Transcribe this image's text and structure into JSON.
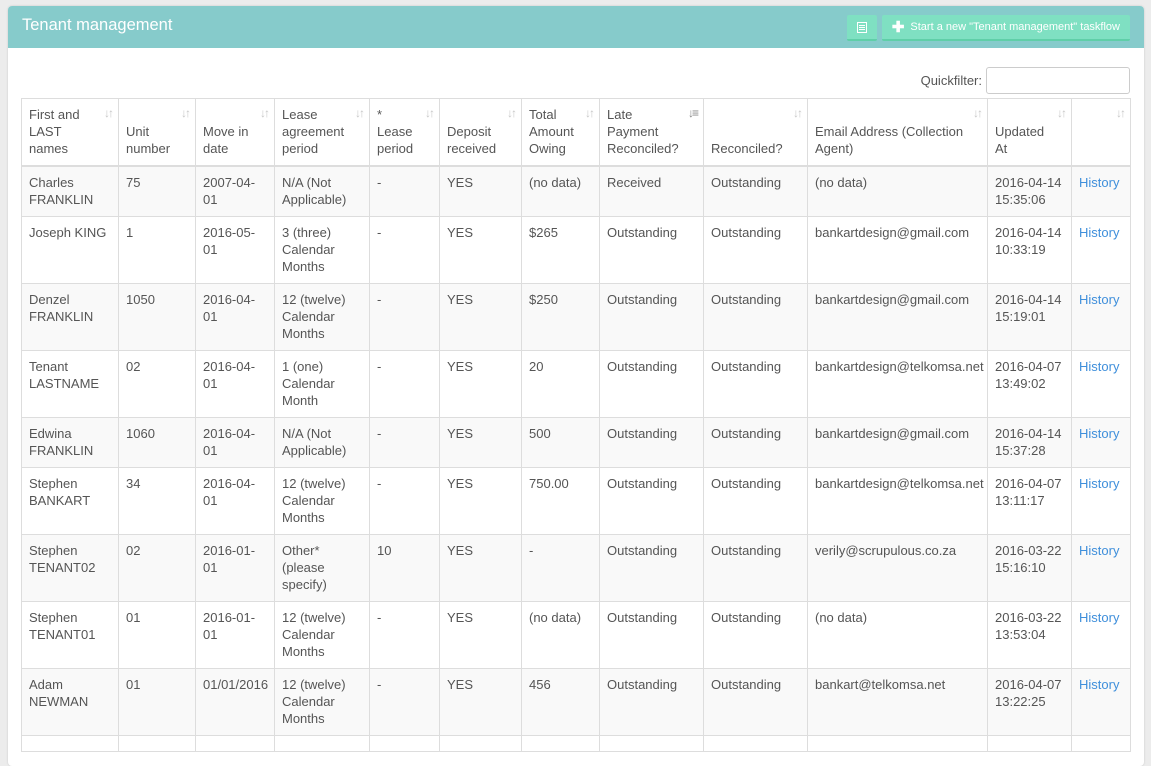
{
  "header": {
    "title": "Tenant management",
    "list_button_icon": "list-icon",
    "start_button_icon": "plus-icon",
    "start_button_label": "Start a new \"Tenant management\"  taskflow"
  },
  "filter": {
    "label": "Quickfilter:",
    "value": "",
    "placeholder": ""
  },
  "table": {
    "columns": [
      {
        "label": "First and LAST names",
        "sort": "unsorted"
      },
      {
        "label": "Unit number",
        "sort": "unsorted"
      },
      {
        "label": "Move in date",
        "sort": "unsorted"
      },
      {
        "label": "Lease agreement period",
        "sort": "unsorted"
      },
      {
        "label": "* Lease period",
        "sort": "unsorted"
      },
      {
        "label": "Deposit received",
        "sort": "unsorted"
      },
      {
        "label": "Total Amount Owing",
        "sort": "unsorted"
      },
      {
        "label": "Late Payment Reconciled?",
        "sort": "descending"
      },
      {
        "label": "Reconciled?",
        "sort": "unsorted"
      },
      {
        "label": "Email Address (Collection Agent)",
        "sort": "unsorted"
      },
      {
        "label": "Updated At",
        "sort": "unsorted"
      },
      {
        "label": "",
        "sort": "unsorted"
      }
    ],
    "rows": [
      [
        "Charles FRANKLIN",
        "75",
        "2007-04-01",
        "N/A (Not Applicable)",
        "-",
        "YES",
        "(no data)",
        "Received",
        "Outstanding",
        "(no data)",
        "2016-04-14 15:35:06",
        "History"
      ],
      [
        "Joseph KING",
        "1",
        "2016-05-01",
        "3 (three) Calendar Months",
        "-",
        "YES",
        "$265",
        "Outstanding",
        "Outstanding",
        "bankartdesign@gmail.com",
        "2016-04-14 10:33:19",
        "History"
      ],
      [
        "Denzel FRANKLIN",
        "1050",
        "2016-04-01",
        "12 (twelve) Calendar Months",
        "-",
        "YES",
        "$250",
        "Outstanding",
        "Outstanding",
        "bankartdesign@gmail.com",
        "2016-04-14 15:19:01",
        "History"
      ],
      [
        "Tenant LASTNAME",
        "02",
        "2016-04-01",
        "1 (one) Calendar Month",
        "-",
        "YES",
        "20",
        "Outstanding",
        "Outstanding",
        "bankartdesign@telkomsa.net",
        "2016-04-07 13:49:02",
        "History"
      ],
      [
        "Edwina FRANKLIN",
        "1060",
        "2016-04-01",
        "N/A (Not Applicable)",
        "-",
        "YES",
        "500",
        "Outstanding",
        "Outstanding",
        "bankartdesign@gmail.com",
        "2016-04-14 15:37:28",
        "History"
      ],
      [
        "Stephen BANKART",
        "34",
        "2016-04-01",
        "12 (twelve) Calendar Months",
        "-",
        "YES",
        "750.00",
        "Outstanding",
        "Outstanding",
        "bankartdesign@telkomsa.net",
        "2016-04-07 13:11:17",
        "History"
      ],
      [
        "Stephen TENANT02",
        "02",
        "2016-01-01",
        "Other* (please specify)",
        "10",
        "YES",
        "-",
        "Outstanding",
        "Outstanding",
        "verily@scrupulous.co.za",
        "2016-03-22 15:16:10",
        "History"
      ],
      [
        "Stephen TENANT01",
        "01",
        "2016-01-01",
        "12 (twelve) Calendar Months",
        "-",
        "YES",
        "(no data)",
        "Outstanding",
        "Outstanding",
        "(no data)",
        "2016-03-22 13:53:04",
        "History"
      ],
      [
        "Adam NEWMAN",
        "01",
        "01/01/2016",
        "12 (twelve) Calendar Months",
        "-",
        "YES",
        "456",
        "Outstanding",
        "Outstanding",
        "bankart@telkomsa.net",
        "2016-04-07 13:22:25",
        "History"
      ],
      [
        "",
        "",
        "",
        "",
        "",
        "",
        "",
        "",
        "",
        "",
        "",
        ""
      ]
    ]
  },
  "colors": {
    "header_bg": "#86cbcb",
    "button_bg": "#7fe0c2",
    "link": "#3f8fdb"
  }
}
